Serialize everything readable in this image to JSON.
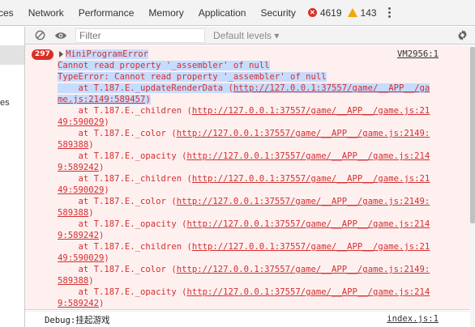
{
  "tabs": [
    {
      "label": "ces"
    },
    {
      "label": "Network"
    },
    {
      "label": "Performance"
    },
    {
      "label": "Memory"
    },
    {
      "label": "Application"
    },
    {
      "label": "Security"
    }
  ],
  "counts": {
    "errors": "4619",
    "warnings": "143"
  },
  "sidebar": {
    "partial_label": "es"
  },
  "toolbar": {
    "filter_placeholder": "Filter",
    "levels_label": "Default levels ▾"
  },
  "error": {
    "count_badge": "297",
    "source": "VM2956:1",
    "lines": [
      {
        "text": "MiniProgramError",
        "kind": "title",
        "highlight": true
      },
      {
        "text": "Cannot read property '_assembler' of null",
        "kind": "plain",
        "highlight": true
      },
      {
        "text": "TypeError: Cannot read property '_assembler' of null",
        "kind": "plain",
        "highlight": true
      },
      {
        "prefix": "    at T.187.E._updateRenderData (",
        "url": "http://127.0.0.1:37557/game/__APP__/ga",
        "highlight": true
      },
      {
        "url": "me.js:2149:589457",
        "suffix": ")",
        "highlight": true
      },
      {
        "prefix": "    at T.187.E._children (",
        "url": "http://127.0.0.1:37557/game/__APP__/game.js:21"
      },
      {
        "url": "49:590029",
        "suffix": ")"
      },
      {
        "prefix": "    at T.187.E._color (",
        "url": "http://127.0.0.1:37557/game/__APP__/game.js:2149:"
      },
      {
        "url": "589388",
        "suffix": ")"
      },
      {
        "prefix": "    at T.187.E._opacity (",
        "url": "http://127.0.0.1:37557/game/__APP__/game.js:214"
      },
      {
        "url": "9:589242",
        "suffix": ")"
      },
      {
        "prefix": "    at T.187.E._children (",
        "url": "http://127.0.0.1:37557/game/__APP__/game.js:21"
      },
      {
        "url": "49:590029",
        "suffix": ")"
      },
      {
        "prefix": "    at T.187.E._color (",
        "url": "http://127.0.0.1:37557/game/__APP__/game.js:2149:"
      },
      {
        "url": "589388",
        "suffix": ")"
      },
      {
        "prefix": "    at T.187.E._opacity (",
        "url": "http://127.0.0.1:37557/game/__APP__/game.js:214"
      },
      {
        "url": "9:589242",
        "suffix": ")"
      },
      {
        "prefix": "    at T.187.E._children (",
        "url": "http://127.0.0.1:37557/game/__APP__/game.js:21"
      },
      {
        "url": "49:590029",
        "suffix": ")"
      },
      {
        "prefix": "    at T.187.E._color (",
        "url": "http://127.0.0.1:37557/game/__APP__/game.js:2149:"
      },
      {
        "url": "589388",
        "suffix": ")"
      },
      {
        "prefix": "    at T.187.E._opacity (",
        "url": "http://127.0.0.1:37557/game/__APP__/game.js:214"
      },
      {
        "url": "9:589242",
        "suffix": ")"
      }
    ]
  },
  "debug": {
    "text": "Debug:挂起游戏",
    "source": "index.js:1"
  },
  "colors": {
    "error": "#d32f2f",
    "error_bg": "#fff0f0",
    "highlight": "#c6dcff"
  }
}
